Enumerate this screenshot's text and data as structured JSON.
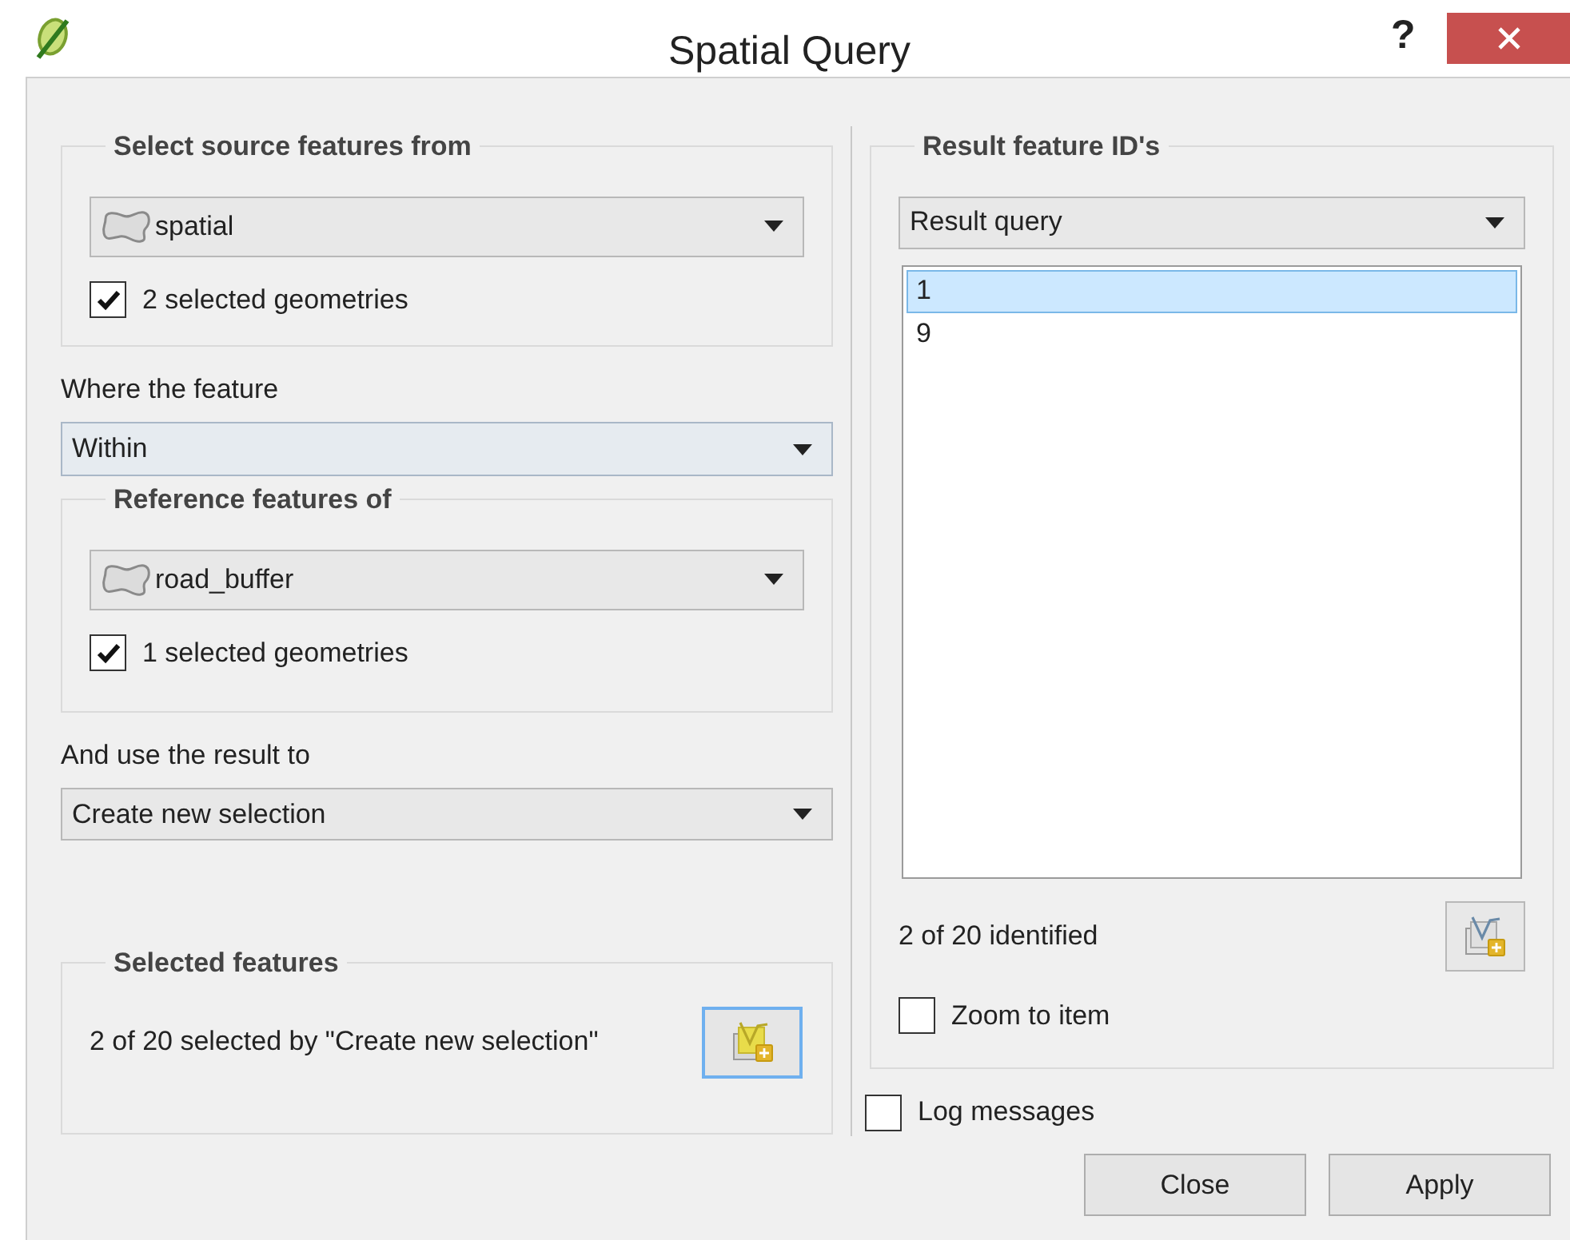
{
  "window": {
    "title": "Spatial Query",
    "help": "?"
  },
  "source": {
    "legend": "Select source features from",
    "layer": "spatial",
    "selected_only": {
      "label": "2 selected geometries",
      "checked": true
    }
  },
  "where": {
    "label": "Where the feature",
    "value": "Within"
  },
  "reference": {
    "legend": "Reference features of",
    "layer": "road_buffer",
    "selected_only": {
      "label": "1 selected geometries",
      "checked": true
    }
  },
  "result_use": {
    "label": "And use the result to",
    "value": "Create new selection"
  },
  "selected_features": {
    "legend": "Selected features",
    "text": "2 of 20 selected by \"Create new selection\""
  },
  "results": {
    "legend": "Result feature ID's",
    "query": "Result query",
    "ids": [
      {
        "label": "1",
        "selected": true
      },
      {
        "label": "9",
        "selected": false
      }
    ],
    "count": "2 of 20 identified",
    "zoom_to_item": {
      "label": "Zoom to item",
      "checked": false
    }
  },
  "log_messages": {
    "label": "Log messages",
    "checked": false
  },
  "buttons": [
    "Close",
    "Apply"
  ]
}
